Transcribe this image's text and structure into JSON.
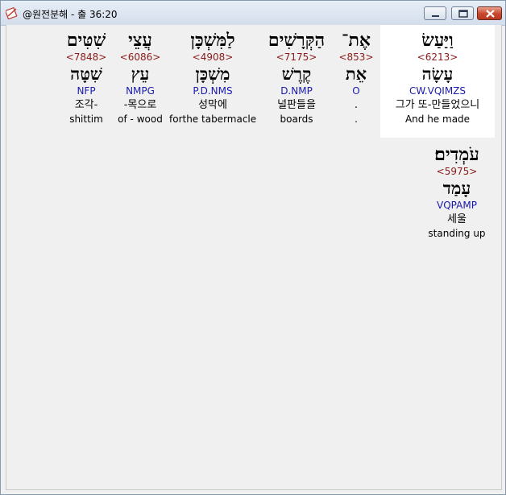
{
  "window": {
    "title": "@원전분해 - 출 36:20"
  },
  "words": [
    {
      "hebrew": "וַיַּעַשׂ",
      "strong": "<6213>",
      "lemma": "עָשָׂה",
      "parse": "CW.VQIMZS",
      "korean": "그가 또-만들었으니",
      "english": "And he made",
      "highlighted": true
    },
    {
      "hebrew": "אֶת־",
      "strong": "<853>",
      "lemma": "אֵת",
      "parse": "O",
      "korean": ".",
      "english": ".",
      "highlighted": false
    },
    {
      "hebrew": "הַקְּרָשִׁים",
      "strong": "<7175>",
      "lemma": "קֶרֶשׁ",
      "parse": "D.NMP",
      "korean": "널판들을",
      "english": "boards",
      "highlighted": false
    },
    {
      "hebrew": "לַמִּשְׁכָּן",
      "strong": "<4908>",
      "lemma": "מִשְׁכָּן",
      "parse": "P.D.NMS",
      "korean": "성막에",
      "english": "forthe tabermacle",
      "highlighted": false
    },
    {
      "hebrew": "עֲצֵי",
      "strong": "<6086>",
      "lemma": "עֵץ",
      "parse": "NMPG",
      "korean": "-목으로",
      "english": "of - wood",
      "highlighted": false
    },
    {
      "hebrew": "שִׁטִּים",
      "strong": "<7848>",
      "lemma": "שִׁטָּה",
      "parse": "NFP",
      "korean": "조각-",
      "english": "shittim",
      "highlighted": false
    },
    {
      "hebrew": "עֹמְדִים׃",
      "strong": "<5975>",
      "lemma": "עָמַד",
      "parse": "VQPAMP",
      "korean": "세울",
      "english": "standing up",
      "highlighted": false
    }
  ]
}
